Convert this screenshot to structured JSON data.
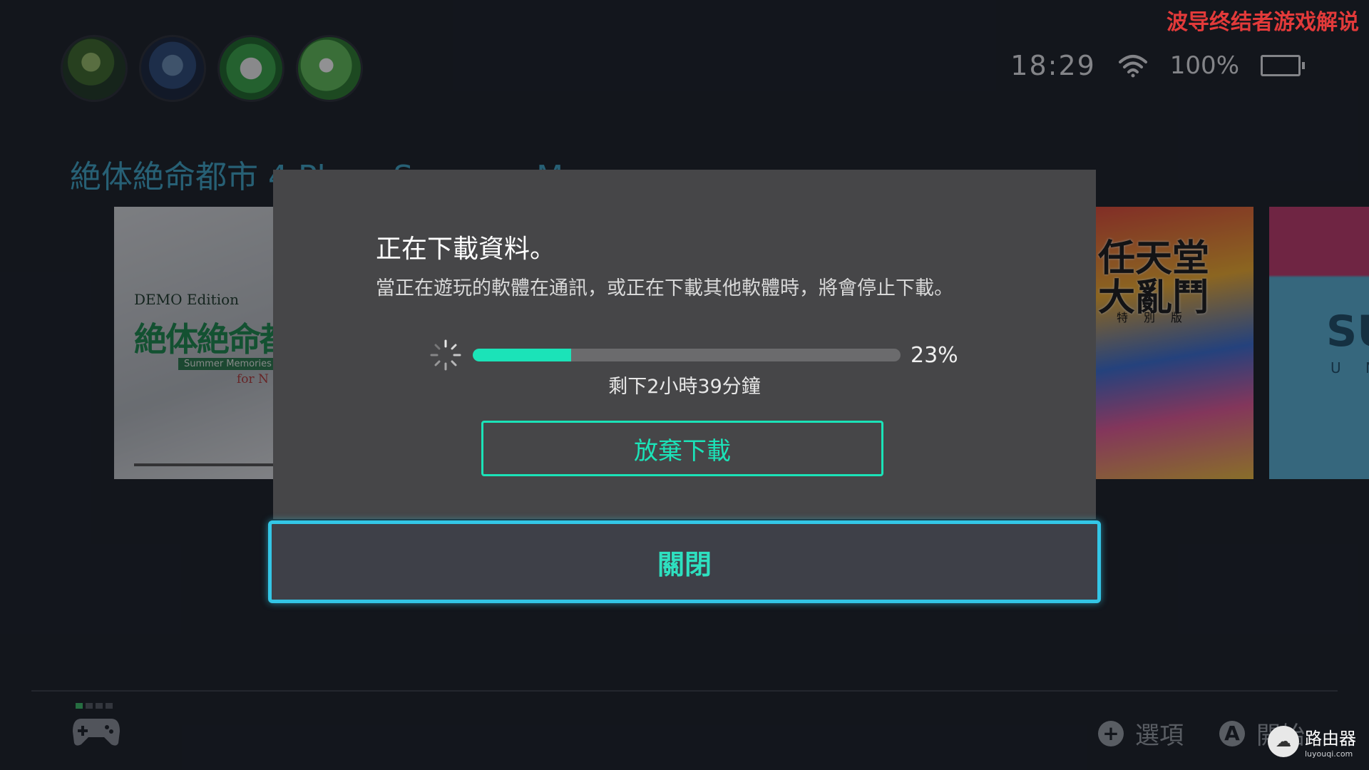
{
  "watermark_top": "波导终结者游戏解说",
  "watermark_bottom": {
    "site": "路由器",
    "url": "luyouqi.com"
  },
  "header": {
    "avatars": [
      "user-1",
      "user-2",
      "user-3",
      "user-4"
    ],
    "time": "18:29",
    "battery": "100%",
    "battery_level": 1.0
  },
  "home": {
    "game_title": "絶体絶命都市 4 Plus - Summer Memo",
    "tiles": [
      {
        "name": "demo",
        "label": "DEMO Edition",
        "logo": "絶体絶命都",
        "subtitle": "Summer Memories",
        "for": "for N"
      },
      {
        "name": "smash",
        "logo": "任天堂\n大亂鬥",
        "subtitle": "特別版"
      },
      {
        "name": "sun",
        "logo": "SU",
        "subtitle": "U N"
      }
    ]
  },
  "dialog": {
    "title": "正在下載資料。",
    "message": "當正在遊玩的軟體在通訊，或正在下載其他軟體時，將會停止下載。",
    "progress": 0.23,
    "progress_label": "23%",
    "remaining": "剩下2小時39分鐘",
    "cancel_label": "放棄下載",
    "close_label": "關閉"
  },
  "footer": {
    "options_label": "選項",
    "options_icon": "+",
    "start_label": "開始",
    "start_icon": "A"
  },
  "colors": {
    "accent": "#1be3b8",
    "focus": "#33c6e6",
    "dialog_bg": "#464648",
    "background": "#1b1f27"
  }
}
